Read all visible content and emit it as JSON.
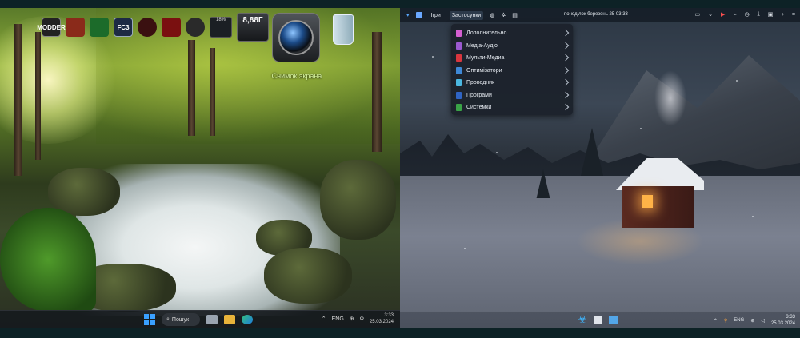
{
  "left_desktop": {
    "widgets": {
      "top_badges": [
        "MODDER",
        "",
        "",
        "FC3",
        "",
        "",
        "",
        ""
      ],
      "gauge_label": "18%",
      "clock_text": "8,88Г",
      "camera_label": "Снимок экрана"
    },
    "taskbar": {
      "search_label": "Пошук",
      "lang": "ENG",
      "ime": "Ф",
      "time": "3:33",
      "date": "25.03.2024"
    }
  },
  "right_desktop": {
    "panel": {
      "menus": [
        "Ігри",
        "Застосунки"
      ],
      "active_menu": "Застосунки",
      "datetime": "понеділок березень 25  03:33"
    },
    "app_menu": [
      {
        "label": "Дополнительно",
        "color": "#d45fd0"
      },
      {
        "label": "Медіа-Аудіо",
        "color": "#9b59d0"
      },
      {
        "label": "Мульти-Медиа",
        "color": "#d9363e"
      },
      {
        "label": "Оптимізатори",
        "color": "#3e88d6"
      },
      {
        "label": "Проводник",
        "color": "#4bb7e0"
      },
      {
        "label": "Програми",
        "color": "#2f64c4"
      },
      {
        "label": "Системки",
        "color": "#3aa347"
      }
    ],
    "dock_tray": {
      "lang": "ENG",
      "time": "3:33",
      "date": "25.03.2024"
    }
  },
  "colors": {
    "background": "#0d2226",
    "win_accent": "#3aa0ff",
    "linux_panel": "#141c26"
  }
}
